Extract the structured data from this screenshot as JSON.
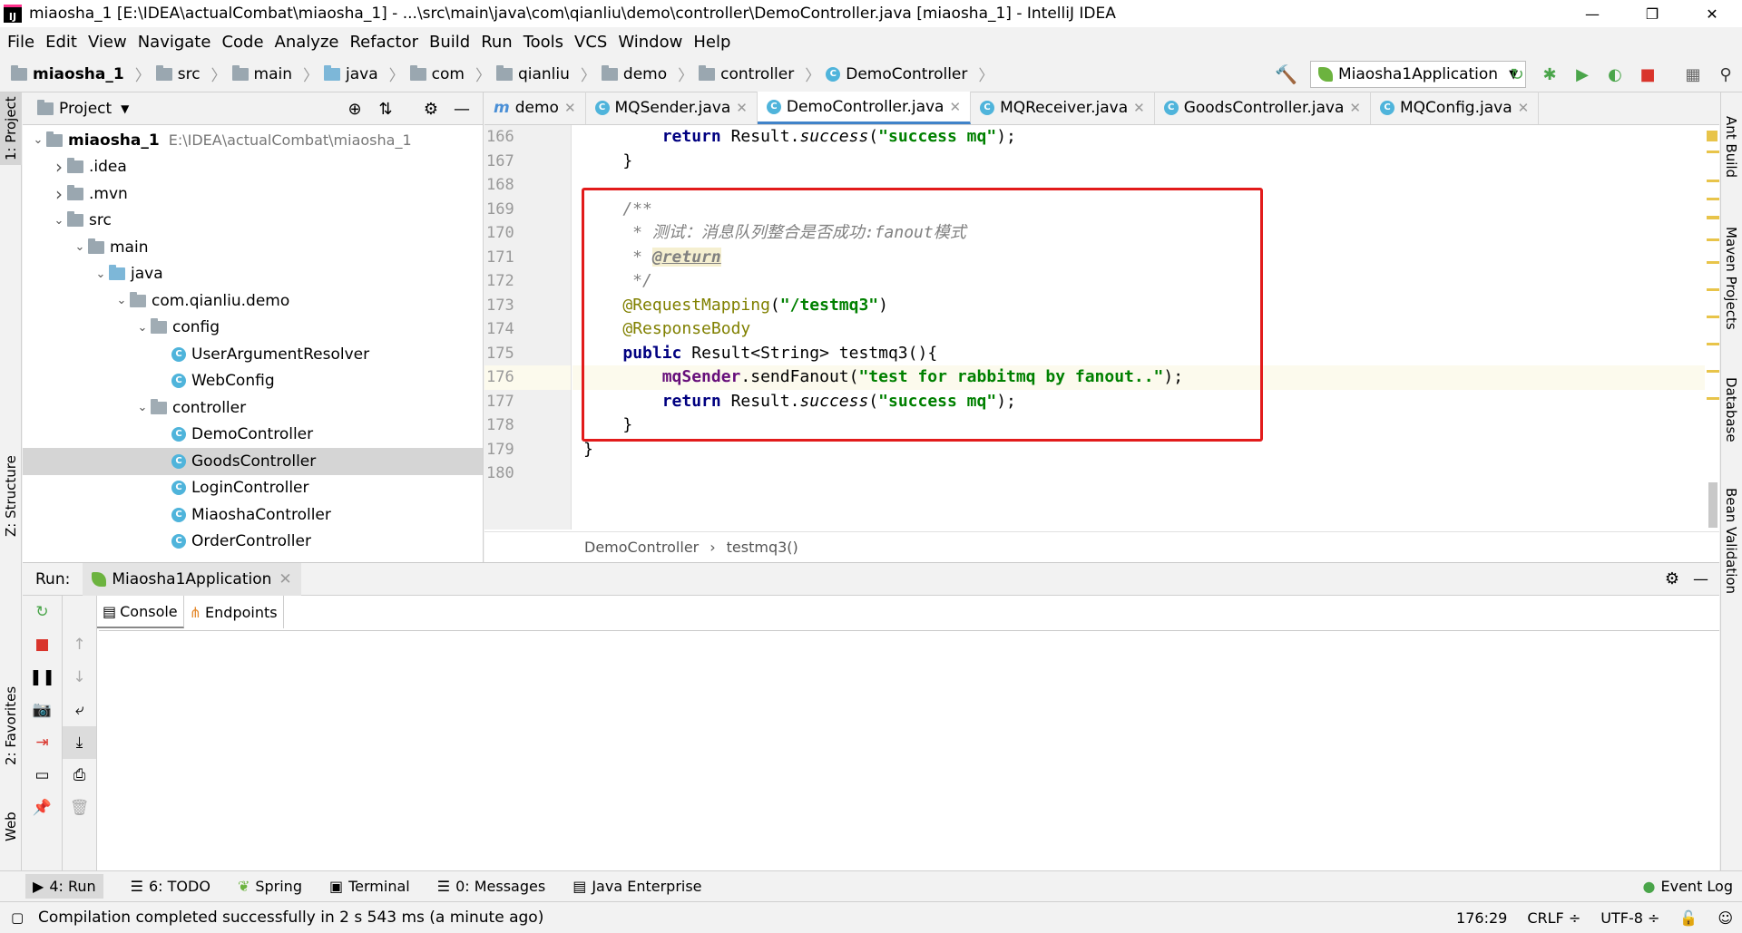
{
  "window": {
    "title": "miaosha_1 [E:\\IDEA\\actualCombat\\miaosha_1] - ...\\src\\main\\java\\com\\qianliu\\demo\\controller\\DemoController.java [miaosha_1] - IntelliJ IDEA",
    "app_icon": "IJ"
  },
  "menu": [
    "File",
    "Edit",
    "View",
    "Navigate",
    "Code",
    "Analyze",
    "Refactor",
    "Build",
    "Run",
    "Tools",
    "VCS",
    "Window",
    "Help"
  ],
  "breadcrumb": [
    "miaosha_1",
    "src",
    "main",
    "java",
    "com",
    "qianliu",
    "demo",
    "controller",
    "DemoController"
  ],
  "run_config": "Miaosha1Application",
  "project_panel": {
    "title": "Project",
    "tree": [
      {
        "label": "miaosha_1",
        "path": "E:\\IDEA\\actualCombat\\miaosha_1",
        "depth": 0,
        "type": "module",
        "open": true
      },
      {
        "label": ".idea",
        "depth": 1,
        "type": "folder",
        "open": false
      },
      {
        "label": ".mvn",
        "depth": 1,
        "type": "folder",
        "open": false
      },
      {
        "label": "src",
        "depth": 1,
        "type": "folder",
        "open": true
      },
      {
        "label": "main",
        "depth": 2,
        "type": "folder",
        "open": true
      },
      {
        "label": "java",
        "depth": 3,
        "type": "folder-blue",
        "open": true
      },
      {
        "label": "com.qianliu.demo",
        "depth": 4,
        "type": "package",
        "open": true
      },
      {
        "label": "config",
        "depth": 5,
        "type": "package",
        "open": true
      },
      {
        "label": "UserArgumentResolver",
        "depth": 6,
        "type": "class"
      },
      {
        "label": "WebConfig",
        "depth": 6,
        "type": "class"
      },
      {
        "label": "controller",
        "depth": 5,
        "type": "package",
        "open": true
      },
      {
        "label": "DemoController",
        "depth": 6,
        "type": "class"
      },
      {
        "label": "GoodsController",
        "depth": 6,
        "type": "class",
        "selected": true
      },
      {
        "label": "LoginController",
        "depth": 6,
        "type": "class"
      },
      {
        "label": "MiaoshaController",
        "depth": 6,
        "type": "class"
      },
      {
        "label": "OrderController",
        "depth": 6,
        "type": "class"
      }
    ]
  },
  "editor_tabs": [
    {
      "label": "demo",
      "icon": "m"
    },
    {
      "label": "MQSender.java",
      "icon": "c"
    },
    {
      "label": "DemoController.java",
      "icon": "c",
      "active": true
    },
    {
      "label": "MQReceiver.java",
      "icon": "c"
    },
    {
      "label": "GoodsController.java",
      "icon": "c"
    },
    {
      "label": "MQConfig.java",
      "icon": "c"
    }
  ],
  "code": {
    "line_numbers": [
      "166",
      "167",
      "168",
      "169",
      "170",
      "171",
      "172",
      "173",
      "174",
      "175",
      "176",
      "177",
      "178",
      "179",
      "180"
    ],
    "current_line": "176",
    "l166": [
      "        ",
      "return",
      " Result.",
      "success",
      "(",
      "\"success mq\"",
      ");"
    ],
    "l167": "    }",
    "l169": "    /**",
    "l170": "     * 测试：消息队列整合是否成功:fanout模式",
    "l171_prefix": "     * ",
    "l171_tag": "@return",
    "l172": "     */",
    "l173_ann": "@RequestMapping",
    "l173_str": "\"/testmq3\"",
    "l174_ann": "@ResponseBody",
    "l175_kw": "public",
    "l175_rest": " Result<String> testmq3(){",
    "l176_field": "mqSender",
    "l176_call": ".sendFanout(",
    "l176_str": "\"test for rabbitmq by fanout..\"",
    "l176_end": ");",
    "l177_str": "\"success mq\"",
    "l178": "    }",
    "l179": "}"
  },
  "editor_crumbs": [
    "DemoController",
    "testmq3()"
  ],
  "run_panel": {
    "label": "Run:",
    "tab": "Miaosha1Application",
    "console_tab": "Console",
    "endpoints_tab": "Endpoints"
  },
  "left_tools": [
    "1: Project",
    "Z: Structure",
    "2: Favorites",
    "Web"
  ],
  "right_tools": [
    "Ant Build",
    "Maven Projects",
    "Database",
    "Bean Validation"
  ],
  "bottom_tools": [
    {
      "label": "4: Run",
      "active": true
    },
    {
      "label": "6: TODO"
    },
    {
      "label": "Spring"
    },
    {
      "label": "Terminal"
    },
    {
      "label": "0: Messages"
    },
    {
      "label": "Java Enterprise"
    }
  ],
  "event_log": "Event Log",
  "status": {
    "message": "Compilation completed successfully in 2 s 543 ms (a minute ago)",
    "position": "176:29",
    "line_sep": "CRLF ÷",
    "encoding": "UTF-8 ÷"
  },
  "colors": {
    "accent": "#4083c9",
    "highlight_box": "#e21b1b"
  }
}
